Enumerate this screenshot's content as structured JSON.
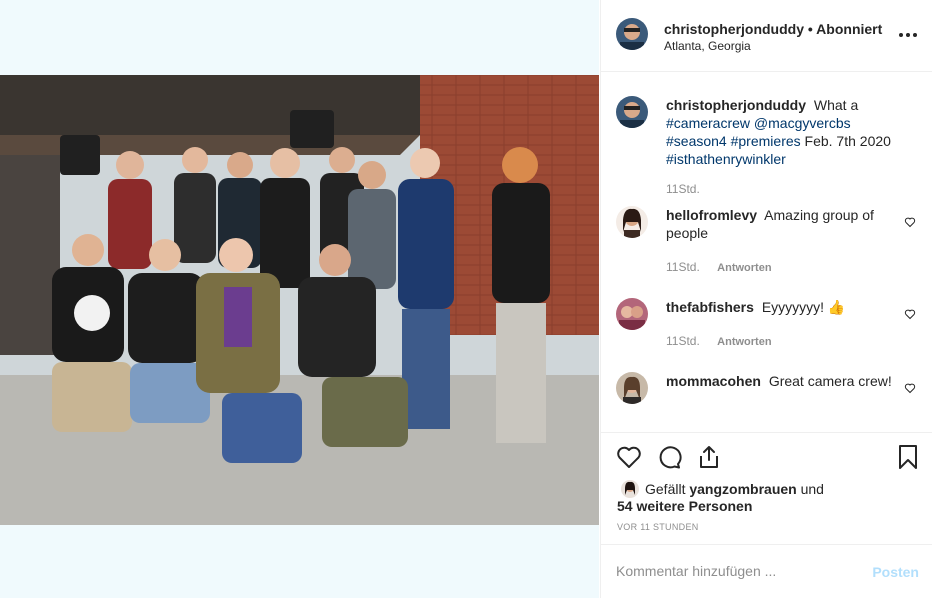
{
  "post": {
    "username": "christopherjonduddy",
    "separator": "•",
    "follow_status": "Abonniert",
    "location": "Atlanta, Georgia",
    "photo_alt": "Kamerateam-Gruppenfoto"
  },
  "caption": {
    "username": "christopherjonduddy",
    "text_before": "What a",
    "tag1": "#cameracrew",
    "mention": "@macgyvercbs",
    "tag2": "#season4",
    "tag3": "#premieres",
    "text_after": "Feb. 7th 2020",
    "tag4": "#isthathenrywinkler",
    "time": "11Std."
  },
  "comments": [
    {
      "username": "hellofromlevy",
      "text": "Amazing group of people",
      "time": "11Std.",
      "reply": "Antworten"
    },
    {
      "username": "thefabfishers",
      "text": "Eyyyyyyy! 👍",
      "time": "11Std.",
      "reply": "Antworten"
    },
    {
      "username": "mommacohen",
      "text": "Great camera crew!",
      "time": ""
    }
  ],
  "actions": {
    "icons": [
      "heart-icon",
      "comment-icon",
      "share-icon",
      "bookmark-icon"
    ]
  },
  "likes": {
    "prefix": "Gefällt",
    "user": "yangzombrauen",
    "conjunction": "und",
    "others": "54 weitere Personen"
  },
  "timestamp": "VOR 11 STUNDEN",
  "comment_box": {
    "placeholder": "Kommentar hinzufügen ...",
    "post_label": "Posten"
  },
  "colors": {
    "link": "#00376b",
    "post_button": "#b2dffc",
    "muted": "#8e8e8e",
    "media_bg": "#f0fafd"
  }
}
